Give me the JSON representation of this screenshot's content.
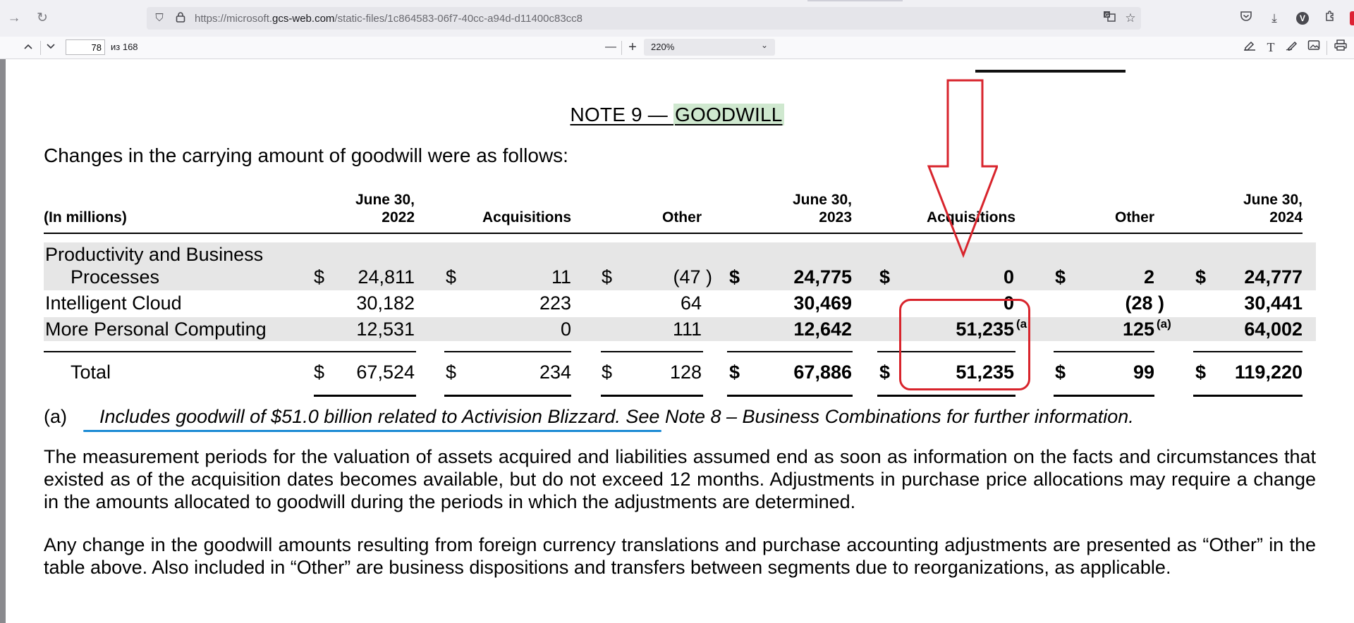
{
  "browser": {
    "url_prefix": "https://microsoft.",
    "url_domain": "gcs-web.com",
    "url_path": "/static-files/1c864583-06f7-40cc-a94d-d11400c83cc8",
    "profile_badge": "V",
    "icons": [
      "forward-icon",
      "reload-icon",
      "shield-icon",
      "lock-icon",
      "translate-icon",
      "bookmark-star-icon",
      "pocket-icon",
      "download-icon",
      "profile-icon",
      "extensions-icon"
    ]
  },
  "pdf_toolbar": {
    "page_number": "78",
    "page_of": "из 168",
    "zoom_minus": "—",
    "zoom_plus": "+",
    "zoom_value": "220%",
    "icons": [
      "prev-page-icon",
      "next-page-icon",
      "highlight-icon",
      "text-icon",
      "draw-icon",
      "image-icon",
      "print-icon"
    ]
  },
  "document": {
    "title_prefix": "NOTE 9 — ",
    "title_highlight": "GOODWILL",
    "intro": "Changes in the carrying amount of goodwill were as follows:",
    "table": {
      "unit_label": "(In millions)",
      "col_headers": [
        {
          "line1": "June 30,",
          "line2": "2022"
        },
        {
          "line1": "",
          "line2": "Acquisitions"
        },
        {
          "line1": "",
          "line2": "Other"
        },
        {
          "line1": "June 30,",
          "line2": "2023"
        },
        {
          "line1": "",
          "line2": "Acquisitions"
        },
        {
          "line1": "",
          "line2": "Other"
        },
        {
          "line1": "June 30,",
          "line2": "2024"
        }
      ],
      "currency": "$",
      "rows": [
        {
          "label1": "Productivity and Business",
          "label2": "Processes",
          "values": [
            "24,811",
            "11",
            "(47 )",
            "24,775",
            "0",
            "2",
            "24,777"
          ]
        },
        {
          "label1": "Intelligent Cloud",
          "values": [
            "30,182",
            "223",
            "64",
            "30,469",
            "0",
            "(28 )",
            "30,441"
          ]
        },
        {
          "label1": "More Personal Computing",
          "values": [
            "12,531",
            "0",
            "111",
            "12,642",
            "51,235",
            "125",
            "64,002"
          ],
          "notes": [
            "",
            "",
            "",
            "",
            "(a",
            "(a)",
            ""
          ]
        }
      ],
      "total": {
        "label": "Total",
        "values": [
          "67,524",
          "234",
          "128",
          "67,886",
          "51,235",
          "99",
          "119,220"
        ]
      }
    },
    "footnote": {
      "marker": "(a)",
      "text": "Includes goodwill of $51.0 billion related to Activision Blizzard. See Note 8 – Business Combinations for further information."
    },
    "paragraphs": [
      "The measurement periods for the valuation of assets acquired and liabilities assumed end as soon as information on the facts and circumstances that existed as of the acquisition dates becomes available, but do not exceed 12 months. Adjustments in purchase price allocations may require a change in the amounts allocated to goodwill during the periods in which the adjustments are determined.",
      "Any change in the goodwill amounts resulting from foreign currency translations and purchase accounting adjustments are presented as “Other” in the table above. Also included in “Other” are business dispositions and transfers between segments due to reorganizations, as applicable."
    ],
    "annotation_color": "#d8242c",
    "underline_color": "#1a8ad4"
  }
}
